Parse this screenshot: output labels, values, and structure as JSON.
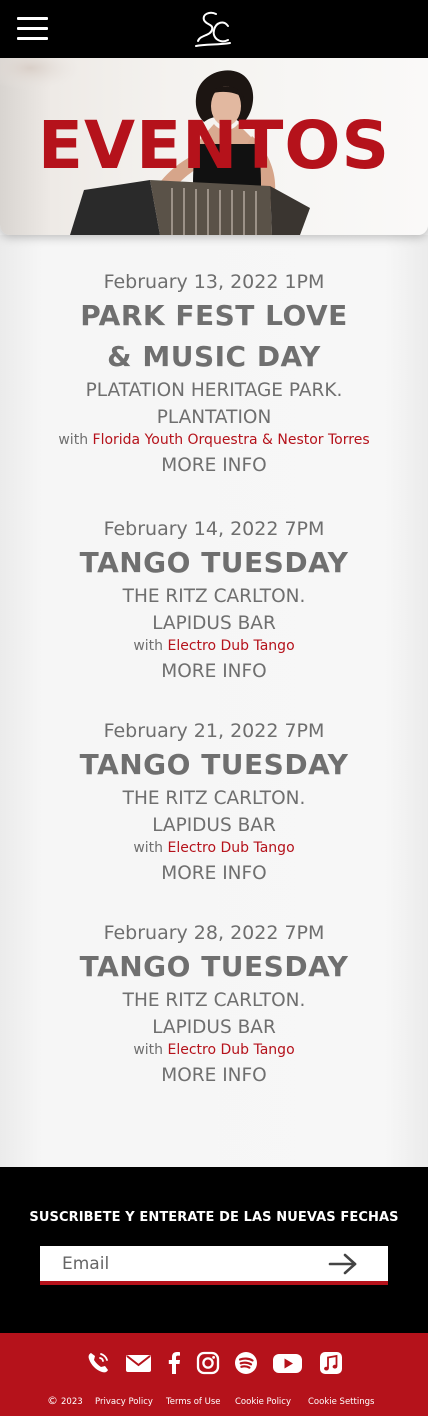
{
  "header": {
    "menu_icon": "hamburger-menu-icon",
    "logo_icon": "sc-monogram-logo"
  },
  "hero": {
    "title": "EVENTOS"
  },
  "events": [
    {
      "date": "February 13, 2022 1PM",
      "title_lines": [
        "PARK FEST LOVE",
        "& MUSIC DAY"
      ],
      "venue_lines": [
        "PLATATION HERITAGE PARK.",
        "PLANTATION"
      ],
      "with_label": "with",
      "artist": "Florida Youth Orquestra & Nestor Torres",
      "more_info": "MORE INFO"
    },
    {
      "date": "February 14, 2022 7PM",
      "title_lines": [
        "TANGO TUESDAY"
      ],
      "venue_lines": [
        "THE RITZ CARLTON.",
        "LAPIDUS BAR"
      ],
      "with_label": "with",
      "artist": "Electro Dub Tango",
      "more_info": "MORE INFO"
    },
    {
      "date": "February 21, 2022 7PM",
      "title_lines": [
        "TANGO TUESDAY"
      ],
      "venue_lines": [
        "THE RITZ CARLTON.",
        "LAPIDUS BAR"
      ],
      "with_label": "with",
      "artist": "Electro Dub Tango",
      "more_info": "MORE INFO"
    },
    {
      "date": "February 28, 2022 7PM",
      "title_lines": [
        "TANGO TUESDAY"
      ],
      "venue_lines": [
        "THE RITZ CARLTON.",
        "LAPIDUS BAR"
      ],
      "with_label": "with",
      "artist": "Electro Dub Tango",
      "more_info": "MORE INFO"
    }
  ],
  "subscribe": {
    "title": "SUSCRIBETE Y ENTERATE DE LAS NUEVAS FECHAS",
    "email_placeholder": "Email",
    "submit_icon": "arrow-right-icon"
  },
  "footer": {
    "social_icons": [
      "phone-icon",
      "mail-icon",
      "facebook-icon",
      "instagram-icon",
      "spotify-icon",
      "youtube-icon",
      "apple-music-icon"
    ],
    "copyright_symbol": "©",
    "year": "2023",
    "links": [
      "Privacy Policy",
      "Terms of Use",
      "Cookie Policy",
      "Cookie Settings"
    ]
  },
  "colors": {
    "brand_red": "#b5121b",
    "text_gray": "#6f6f6f",
    "black": "#000000"
  }
}
